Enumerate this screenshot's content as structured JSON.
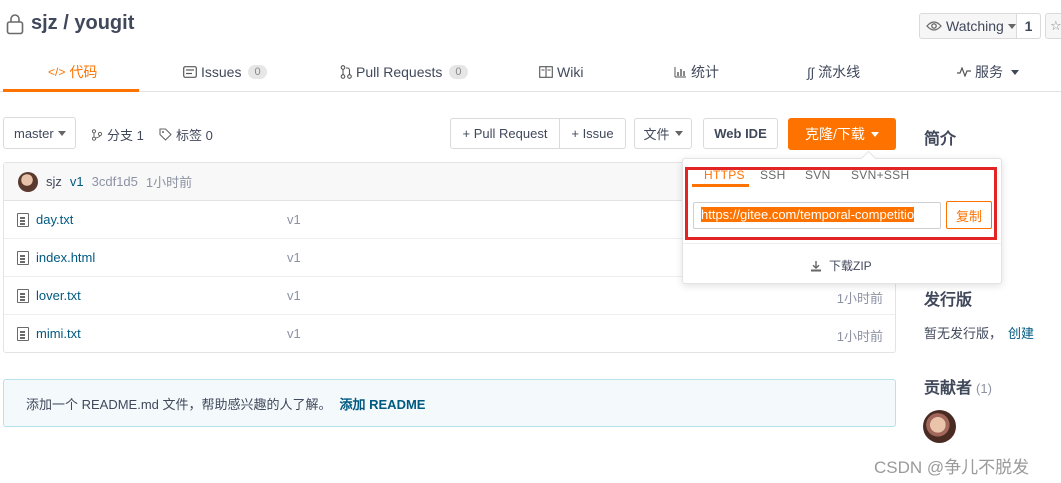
{
  "repo": {
    "owner": "sjz",
    "separator": "/",
    "name": "yougit"
  },
  "watch": {
    "label": "Watching",
    "count": "1"
  },
  "tabs": [
    {
      "label": "代码",
      "icon": "code-icon",
      "active": true
    },
    {
      "label": "Issues",
      "icon": "issues-icon",
      "badge": "0"
    },
    {
      "label": "Pull Requests",
      "icon": "pull-request-icon",
      "badge": "0"
    },
    {
      "label": "Wiki",
      "icon": "wiki-icon"
    },
    {
      "label": "统计",
      "icon": "stats-icon"
    },
    {
      "label": "流水线",
      "icon": "pipeline-icon"
    },
    {
      "label": "服务",
      "icon": "service-icon"
    }
  ],
  "toolbar": {
    "branch": "master",
    "branches_label": "分支 1",
    "tags_label": "标签 0",
    "pull_request": "+ Pull Request",
    "issue": "+ Issue",
    "file": "文件",
    "web_ide": "Web IDE",
    "clone": "克隆/下载"
  },
  "commit": {
    "author": "sjz",
    "message": "v1",
    "hash": "3cdf1d5",
    "time": "1小时前"
  },
  "files": [
    {
      "name": "day.txt",
      "commit": "v1",
      "time": ""
    },
    {
      "name": "index.html",
      "commit": "v1",
      "time": ""
    },
    {
      "name": "lover.txt",
      "commit": "v1",
      "time": "1小时前"
    },
    {
      "name": "mimi.txt",
      "commit": "v1",
      "time": "1小时前"
    }
  ],
  "readme": {
    "text": "添加一个 README.md 文件，帮助感兴趣的人了解。",
    "link": "添加 README"
  },
  "sidebar": {
    "intro_title": "简介",
    "release_title": "发行版",
    "release_text": "暂无发行版，",
    "release_link": "创建",
    "contrib_title": "贡献者",
    "contrib_count": "(1)"
  },
  "clone_panel": {
    "protocols": [
      "HTTPS",
      "SSH",
      "SVN",
      "SVN+SSH"
    ],
    "url": "https://gitee.com/temporal-competitio",
    "copy": "复制",
    "zip": "下载ZIP"
  },
  "watermark": "CSDN @争儿不脱发",
  "colors": {
    "accent": "#fe7300",
    "link": "#005980",
    "highlight_box": "#e22424"
  }
}
